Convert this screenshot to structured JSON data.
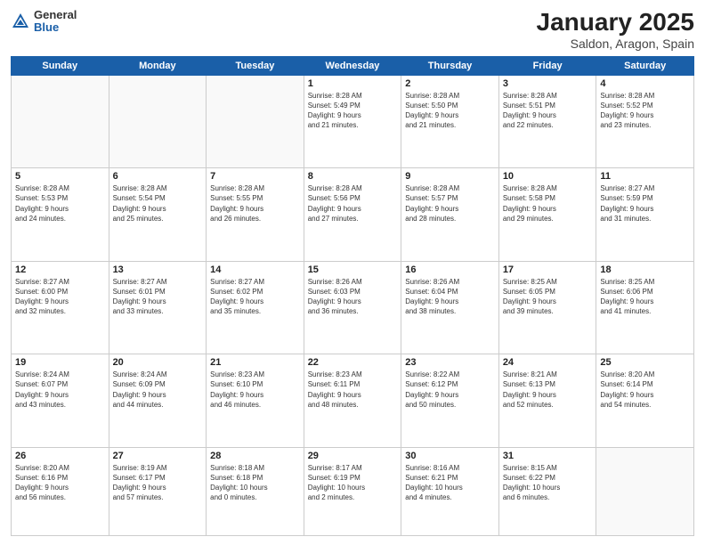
{
  "logo": {
    "general": "General",
    "blue": "Blue"
  },
  "title": {
    "month": "January 2025",
    "location": "Saldon, Aragon, Spain"
  },
  "weekdays": [
    "Sunday",
    "Monday",
    "Tuesday",
    "Wednesday",
    "Thursday",
    "Friday",
    "Saturday"
  ],
  "weeks": [
    [
      {
        "day": "",
        "info": ""
      },
      {
        "day": "",
        "info": ""
      },
      {
        "day": "",
        "info": ""
      },
      {
        "day": "1",
        "info": "Sunrise: 8:28 AM\nSunset: 5:49 PM\nDaylight: 9 hours\nand 21 minutes."
      },
      {
        "day": "2",
        "info": "Sunrise: 8:28 AM\nSunset: 5:50 PM\nDaylight: 9 hours\nand 21 minutes."
      },
      {
        "day": "3",
        "info": "Sunrise: 8:28 AM\nSunset: 5:51 PM\nDaylight: 9 hours\nand 22 minutes."
      },
      {
        "day": "4",
        "info": "Sunrise: 8:28 AM\nSunset: 5:52 PM\nDaylight: 9 hours\nand 23 minutes."
      }
    ],
    [
      {
        "day": "5",
        "info": "Sunrise: 8:28 AM\nSunset: 5:53 PM\nDaylight: 9 hours\nand 24 minutes."
      },
      {
        "day": "6",
        "info": "Sunrise: 8:28 AM\nSunset: 5:54 PM\nDaylight: 9 hours\nand 25 minutes."
      },
      {
        "day": "7",
        "info": "Sunrise: 8:28 AM\nSunset: 5:55 PM\nDaylight: 9 hours\nand 26 minutes."
      },
      {
        "day": "8",
        "info": "Sunrise: 8:28 AM\nSunset: 5:56 PM\nDaylight: 9 hours\nand 27 minutes."
      },
      {
        "day": "9",
        "info": "Sunrise: 8:28 AM\nSunset: 5:57 PM\nDaylight: 9 hours\nand 28 minutes."
      },
      {
        "day": "10",
        "info": "Sunrise: 8:28 AM\nSunset: 5:58 PM\nDaylight: 9 hours\nand 29 minutes."
      },
      {
        "day": "11",
        "info": "Sunrise: 8:27 AM\nSunset: 5:59 PM\nDaylight: 9 hours\nand 31 minutes."
      }
    ],
    [
      {
        "day": "12",
        "info": "Sunrise: 8:27 AM\nSunset: 6:00 PM\nDaylight: 9 hours\nand 32 minutes."
      },
      {
        "day": "13",
        "info": "Sunrise: 8:27 AM\nSunset: 6:01 PM\nDaylight: 9 hours\nand 33 minutes."
      },
      {
        "day": "14",
        "info": "Sunrise: 8:27 AM\nSunset: 6:02 PM\nDaylight: 9 hours\nand 35 minutes."
      },
      {
        "day": "15",
        "info": "Sunrise: 8:26 AM\nSunset: 6:03 PM\nDaylight: 9 hours\nand 36 minutes."
      },
      {
        "day": "16",
        "info": "Sunrise: 8:26 AM\nSunset: 6:04 PM\nDaylight: 9 hours\nand 38 minutes."
      },
      {
        "day": "17",
        "info": "Sunrise: 8:25 AM\nSunset: 6:05 PM\nDaylight: 9 hours\nand 39 minutes."
      },
      {
        "day": "18",
        "info": "Sunrise: 8:25 AM\nSunset: 6:06 PM\nDaylight: 9 hours\nand 41 minutes."
      }
    ],
    [
      {
        "day": "19",
        "info": "Sunrise: 8:24 AM\nSunset: 6:07 PM\nDaylight: 9 hours\nand 43 minutes."
      },
      {
        "day": "20",
        "info": "Sunrise: 8:24 AM\nSunset: 6:09 PM\nDaylight: 9 hours\nand 44 minutes."
      },
      {
        "day": "21",
        "info": "Sunrise: 8:23 AM\nSunset: 6:10 PM\nDaylight: 9 hours\nand 46 minutes."
      },
      {
        "day": "22",
        "info": "Sunrise: 8:23 AM\nSunset: 6:11 PM\nDaylight: 9 hours\nand 48 minutes."
      },
      {
        "day": "23",
        "info": "Sunrise: 8:22 AM\nSunset: 6:12 PM\nDaylight: 9 hours\nand 50 minutes."
      },
      {
        "day": "24",
        "info": "Sunrise: 8:21 AM\nSunset: 6:13 PM\nDaylight: 9 hours\nand 52 minutes."
      },
      {
        "day": "25",
        "info": "Sunrise: 8:20 AM\nSunset: 6:14 PM\nDaylight: 9 hours\nand 54 minutes."
      }
    ],
    [
      {
        "day": "26",
        "info": "Sunrise: 8:20 AM\nSunset: 6:16 PM\nDaylight: 9 hours\nand 56 minutes."
      },
      {
        "day": "27",
        "info": "Sunrise: 8:19 AM\nSunset: 6:17 PM\nDaylight: 9 hours\nand 57 minutes."
      },
      {
        "day": "28",
        "info": "Sunrise: 8:18 AM\nSunset: 6:18 PM\nDaylight: 10 hours\nand 0 minutes."
      },
      {
        "day": "29",
        "info": "Sunrise: 8:17 AM\nSunset: 6:19 PM\nDaylight: 10 hours\nand 2 minutes."
      },
      {
        "day": "30",
        "info": "Sunrise: 8:16 AM\nSunset: 6:21 PM\nDaylight: 10 hours\nand 4 minutes."
      },
      {
        "day": "31",
        "info": "Sunrise: 8:15 AM\nSunset: 6:22 PM\nDaylight: 10 hours\nand 6 minutes."
      },
      {
        "day": "",
        "info": ""
      }
    ]
  ]
}
